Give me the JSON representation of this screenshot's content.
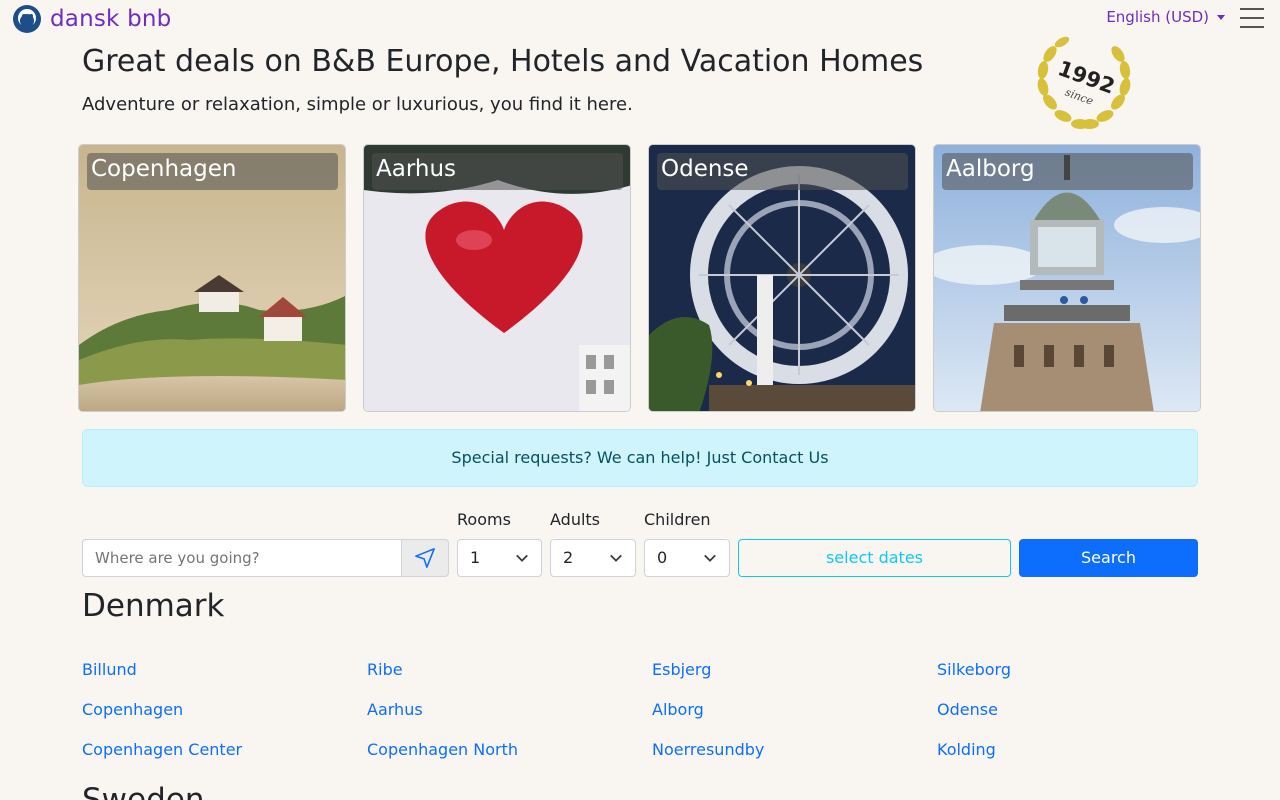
{
  "navbar": {
    "brand": "dansk bnb",
    "language": "English (USD)"
  },
  "hero": {
    "title": "Great deals on B&B Europe, Hotels and Vacation Homes",
    "subtitle": "Adventure or relaxation, simple or luxurious, you find it here.",
    "badge_year": "1992",
    "badge_since": "since"
  },
  "cities": [
    {
      "name": "Copenhagen"
    },
    {
      "name": "Aarhus"
    },
    {
      "name": "Odense"
    },
    {
      "name": "Aalborg"
    }
  ],
  "alert": "Special requests? We can help! Just Contact Us",
  "search": {
    "destination_placeholder": "Where are you going?",
    "rooms_label": "Rooms",
    "rooms_value": "1",
    "adults_label": "Adults",
    "adults_value": "2",
    "children_label": "Children",
    "children_value": "0",
    "dates_label": "select dates",
    "search_label": "Search"
  },
  "denmark": {
    "title": "Denmark",
    "links": [
      [
        "Billund",
        "Ribe",
        "Esbjerg",
        "Silkeborg"
      ],
      [
        "Copenhagen",
        "Aarhus",
        "Alborg",
        "Odense"
      ],
      [
        "Copenhagen Center",
        "Copenhagen North",
        "Noerresundby",
        "Kolding"
      ]
    ]
  },
  "next_section": {
    "title": "Sweden"
  },
  "colors": {
    "brand": "#6f2dbd",
    "primary": "#0d6efd",
    "info": "#0dcaf0",
    "alert_bg": "#cff4fc"
  }
}
